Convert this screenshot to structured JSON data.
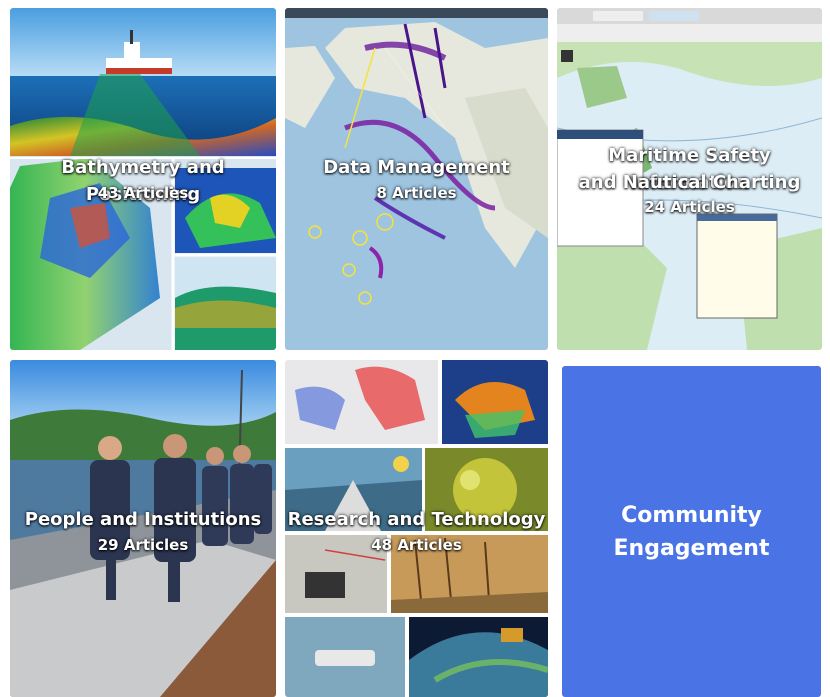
{
  "cards": [
    {
      "title": "Bathymetry and Positioning",
      "count": "43 Articles"
    },
    {
      "title": "Data Management",
      "count": "8 Articles"
    },
    {
      "title_line1": "Maritime Safety Information",
      "title_line2": "and Nautical Charting",
      "count": "24 Articles"
    },
    {
      "title": "People and Institutions",
      "count": "29 Articles"
    },
    {
      "title": "Research and Technology",
      "count": "48 Articles"
    },
    {
      "title_line1": "Community",
      "title_line2": "Engagement"
    }
  ],
  "colors": {
    "community_card": "#4a74e6",
    "text": "#ffffff"
  }
}
